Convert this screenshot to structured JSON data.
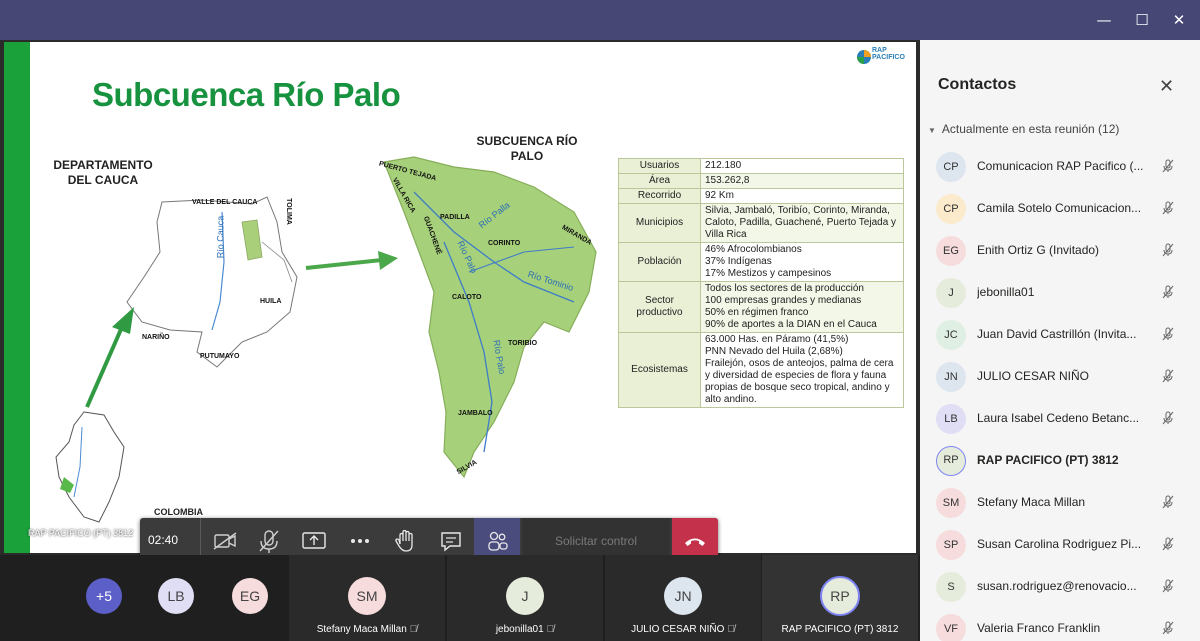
{
  "window": {
    "minimize_glyph": "—",
    "restore_glyph": "☐",
    "close_glyph": "✕"
  },
  "slide": {
    "title": "Subcuenca Río Palo",
    "logo_text_1": "RAP",
    "logo_text_2": "PACIFICO",
    "dep_label": "DEPARTAMENTO DEL CAUCA",
    "sub_label": "SUBCUENCA RÍO PALO",
    "colombia_label": "COLOMBIA",
    "map_labels": {
      "valle": "VALLE DEL CAUCA",
      "tolima": "TOLIMA",
      "huila": "HUILA",
      "narino": "NARIÑO",
      "putumayo": "PUTUMAYO",
      "rio_cauca": "Río Cauca",
      "puerto_tejada": "PUERTO TEJADA",
      "villa_rica": "VILLA RICA",
      "padilla": "PADILLA",
      "guachene": "GUACHENÉ",
      "corinto": "CORINTO",
      "miranda": "MIRANDA",
      "caloto": "CALOTO",
      "toribio": "TORIBIO",
      "jambalo": "JAMBALO",
      "silvia": "SILVIA",
      "rio_palla": "Río Palla",
      "rio_palo": "Río Palo",
      "rio_palo_2": "Río Palo",
      "rio_tominio": "Río Tominio"
    },
    "table": [
      {
        "k": "Usuarios",
        "v": "212.180"
      },
      {
        "k": "Área",
        "v": "153.262,8"
      },
      {
        "k": "Recorrido",
        "v": "92 Km"
      },
      {
        "k": "Municipios",
        "v": "Silvia, Jambaló, Toribío, Corinto, Miranda, Caloto, Padilla, Guachené, Puerto Tejada y Villa Rica"
      },
      {
        "k": "Población",
        "v": "46% Afrocolombianos\n37% Indígenas\n17% Mestizos y campesinos"
      },
      {
        "k": "Sector productivo",
        "v": "Todos los sectores de la producción\n100 empresas grandes y medianas\n50% en régimen franco\n90% de aportes a la DIAN en el Cauca"
      },
      {
        "k": "Ecosistemas",
        "v": "63.000 Has. en Páramo (41,5%)\nPNN Nevado del Huila (2,68%)\nFrailejón, osos de anteojos, palma de cera y diversidad de especies de flora y fauna propias de bosque seco tropical, andino y alto andino."
      }
    ]
  },
  "presenter_tag": "RAP PACIFICO (PT) 3812",
  "controls": {
    "timer": "02:40",
    "request_control": "Solicitar control"
  },
  "strip": {
    "more": "+5",
    "avatars": [
      {
        "initials": "LB",
        "bg": "#e0def5"
      },
      {
        "initials": "EG",
        "bg": "#f6dcdd"
      }
    ],
    "tiles": [
      {
        "initials": "SM",
        "name": "Stefany Maca Millan",
        "bg": "#f6dcdd"
      },
      {
        "initials": "J",
        "name": "jebonilla01",
        "bg": "#e6ecdc"
      },
      {
        "initials": "JN",
        "name": "JULIO CESAR NIÑO",
        "bg": "#dde6ef"
      },
      {
        "initials": "RP",
        "name": "RAP PACIFICO (PT) 3812",
        "bg": "#e6ecdc"
      }
    ]
  },
  "panel": {
    "title": "Contactos",
    "section": "Actualmente en esta reunión (12)",
    "people": [
      {
        "initials": "CP",
        "name": "Comunicacion RAP Pacifico (...",
        "bg": "#dde6ef",
        "bold": false
      },
      {
        "initials": "CP",
        "name": "Camila Sotelo Comunicacion...",
        "bg": "#fbeacc",
        "bold": false
      },
      {
        "initials": "EG",
        "name": "Enith Ortiz G (Invitado)",
        "bg": "#f6dcdd",
        "bold": false
      },
      {
        "initials": "J",
        "name": "jebonilla01",
        "bg": "#e6ecdc",
        "bold": false
      },
      {
        "initials": "JC",
        "name": "Juan David Castrillón (Invita...",
        "bg": "#e0efe4",
        "bold": false
      },
      {
        "initials": "JN",
        "name": "JULIO CESAR NIÑO",
        "bg": "#dde6ef",
        "bold": false
      },
      {
        "initials": "LB",
        "name": "Laura Isabel Cedeno Betanc...",
        "bg": "#e0def5",
        "bold": false
      },
      {
        "initials": "RP",
        "name": "RAP PACIFICO (PT) 3812",
        "bg": "#e6ecdc",
        "bold": true
      },
      {
        "initials": "SM",
        "name": "Stefany Maca Millan",
        "bg": "#f6dcdd",
        "bold": false
      },
      {
        "initials": "SP",
        "name": "Susan Carolina Rodriguez Pi...",
        "bg": "#f6dcdd",
        "bold": false
      },
      {
        "initials": "S",
        "name": "susan.rodriguez@renovacio...",
        "bg": "#e6ecdc",
        "bold": false
      },
      {
        "initials": "VF",
        "name": "Valeria Franco Franklin",
        "bg": "#f6dcdd",
        "bold": false
      }
    ]
  }
}
